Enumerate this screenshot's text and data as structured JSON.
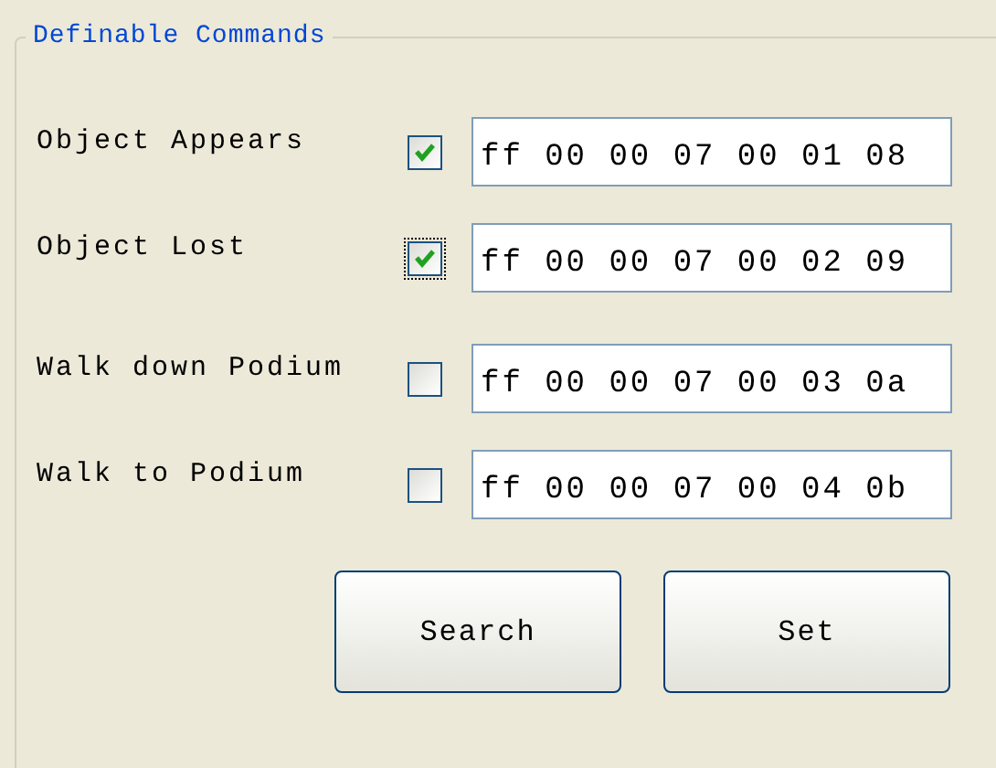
{
  "group": {
    "title": "Definable Commands"
  },
  "commands": [
    {
      "label": "Object Appears",
      "checked": true,
      "focused": false,
      "value": "ff 00 00 07 00 01 08"
    },
    {
      "label": "Object Lost",
      "checked": true,
      "focused": true,
      "value": "ff 00 00 07 00 02 09"
    },
    {
      "label": "Walk down Podium",
      "checked": false,
      "focused": false,
      "value": "ff 00 00 07 00 03 0a"
    },
    {
      "label": "Walk to Podium",
      "checked": false,
      "focused": false,
      "value": "ff 00 00 07 00 04 0b"
    }
  ],
  "buttons": [
    "Search",
    "Set"
  ]
}
